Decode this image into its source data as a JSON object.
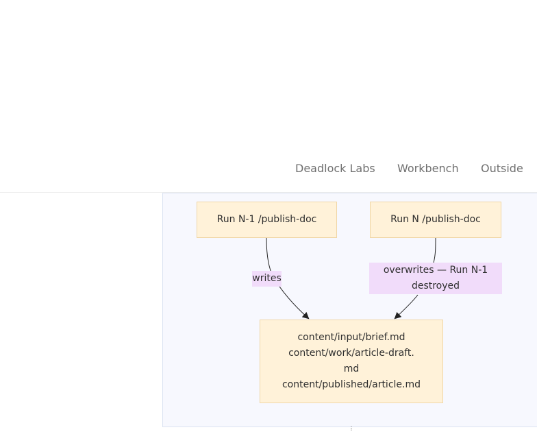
{
  "nav": {
    "items": [
      {
        "label": "Deadlock Labs"
      },
      {
        "label": "Workbench"
      },
      {
        "label": "Outside"
      }
    ]
  },
  "diagram": {
    "nodes": {
      "run_n1": "Run N-1 /publish-doc",
      "run_n": "Run N /publish-doc",
      "content": {
        "line1": "content/input/brief.md",
        "line2": "content/work/article-draft.md",
        "line3": "content/published/article.md"
      }
    },
    "edges": {
      "writes": "writes",
      "overwrites": "overwrites — Run N-1 destroyed"
    }
  },
  "colors": {
    "panel_background": "#f7f8fe",
    "node_fill": "#fff2d9",
    "node_border": "#f0d6a6",
    "edge_label_fill": "#f1dcfa",
    "nav_text": "#6f6f6f"
  }
}
